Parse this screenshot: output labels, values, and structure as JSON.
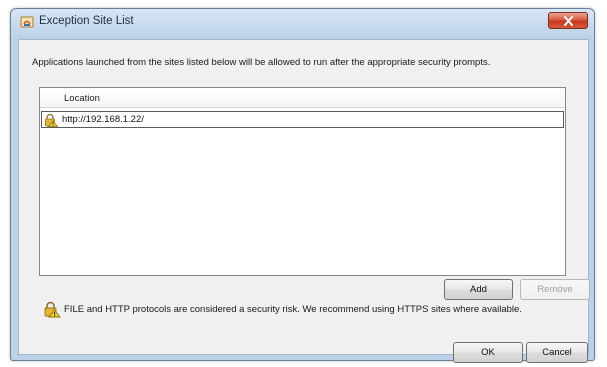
{
  "window": {
    "title": "Exception Site List",
    "title_icon": "java-icon",
    "close_icon": "close-icon"
  },
  "description": "Applications launched from the sites listed below will be allowed to run after the appropriate security prompts.",
  "site_list": {
    "column_header": "Location",
    "rows": [
      {
        "icon": "lock-warning-icon",
        "url": "http://192.168.1.22/"
      }
    ]
  },
  "buttons": {
    "add": "Add",
    "remove": "Remove",
    "ok": "OK",
    "cancel": "Cancel"
  },
  "warning": {
    "icon": "lock-warning-icon",
    "text": "FILE and HTTP protocols are considered a security risk.  We recommend using HTTPS sites where available."
  },
  "colors": {
    "close_button": "#c7351c",
    "titlebar": "#c3d6ec",
    "dialog_background": "#f0f0f0"
  }
}
